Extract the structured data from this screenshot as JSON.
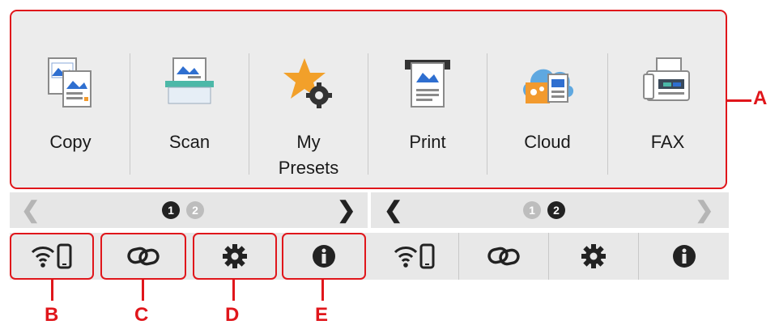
{
  "apps": [
    {
      "label": "Copy",
      "icon": "copy-icon"
    },
    {
      "label": "Scan",
      "icon": "scan-icon"
    },
    {
      "label_line1": "My",
      "label_line2": "Presets",
      "icon": "my-presets-icon"
    },
    {
      "label": "Print",
      "icon": "print-icon"
    },
    {
      "label": "Cloud",
      "icon": "cloud-icon"
    },
    {
      "label": "FAX",
      "icon": "fax-icon"
    }
  ],
  "pager_left": {
    "current": "1",
    "other": "2"
  },
  "pager_right": {
    "other": "1",
    "current": "2"
  },
  "statusbar": [
    {
      "icon": "wifi-phone-icon"
    },
    {
      "icon": "link-icon"
    },
    {
      "icon": "settings-gear-icon"
    },
    {
      "icon": "info-icon"
    }
  ],
  "callouts": {
    "a": "A",
    "b": "B",
    "c": "C",
    "d": "D",
    "e": "E"
  },
  "colors": {
    "callout": "#e0161b",
    "panel": "#ececec",
    "text": "#1a1a1a"
  }
}
